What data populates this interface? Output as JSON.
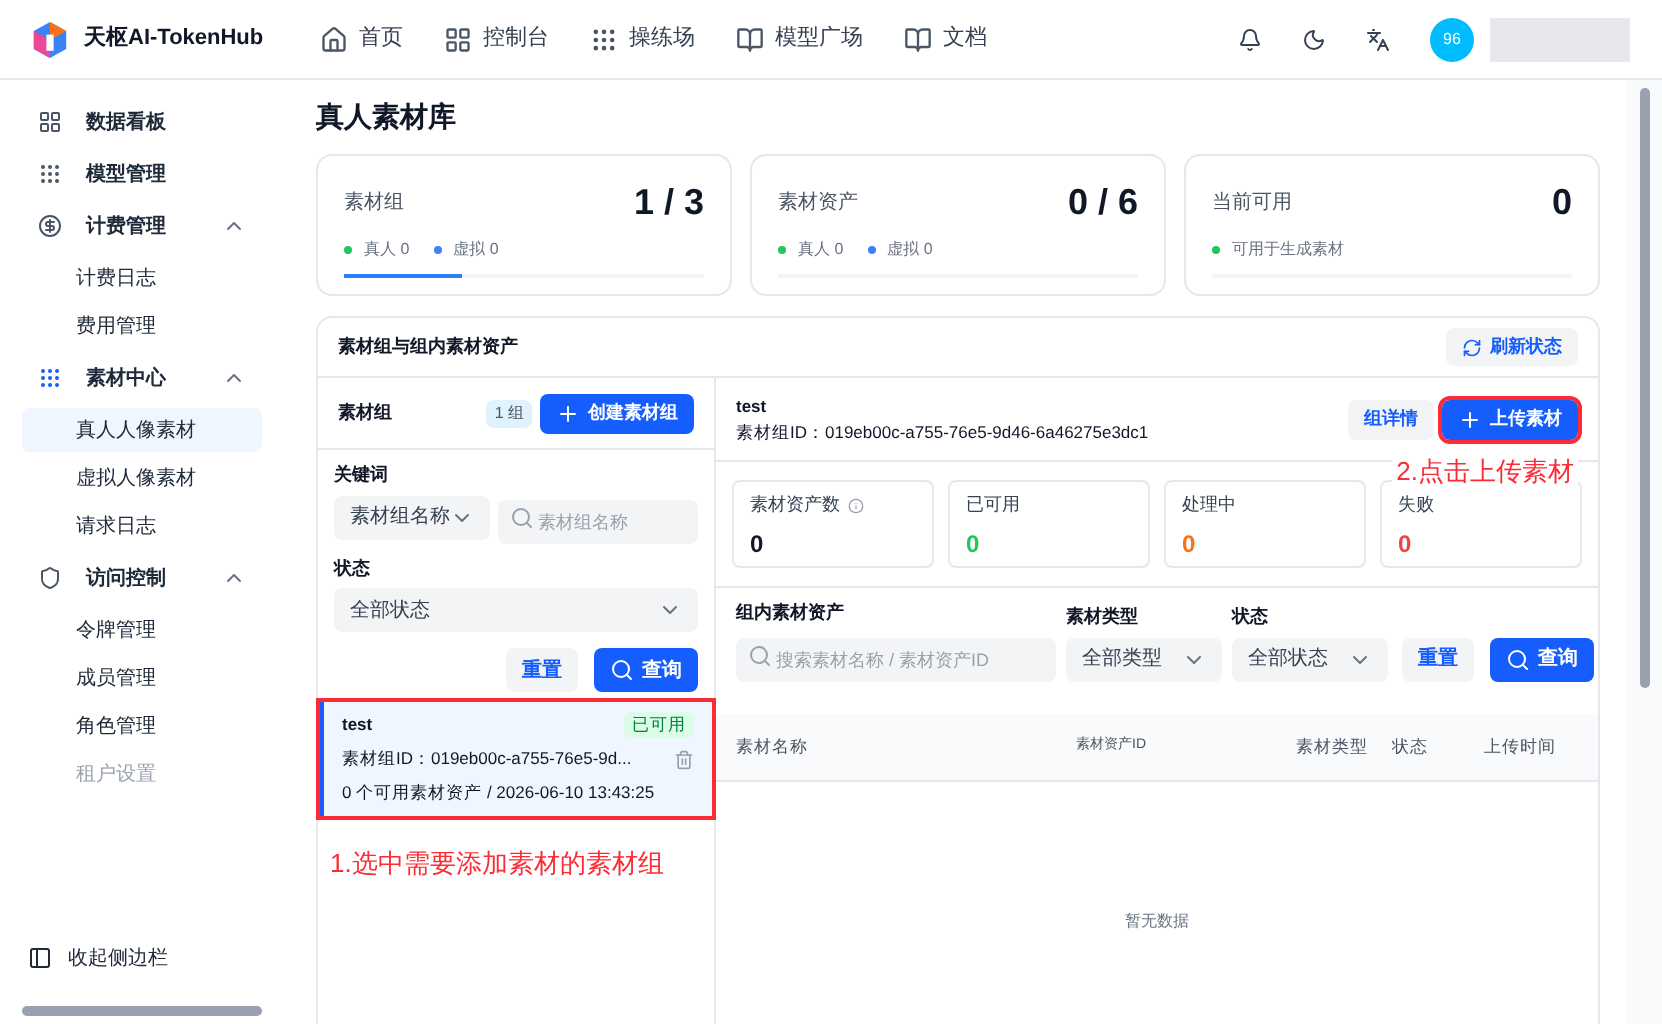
{
  "header": {
    "brand": "天枢AI-TokenHub",
    "nav": [
      {
        "label": "首页",
        "kind": "home"
      },
      {
        "label": "控制台",
        "kind": "grid"
      },
      {
        "label": "操练场",
        "kind": "dots"
      },
      {
        "label": "模型广场",
        "kind": "book"
      },
      {
        "label": "文档",
        "kind": "book"
      }
    ],
    "avatar": "96"
  },
  "sidebar": {
    "items": [
      {
        "label": "数据看板",
        "kind": "grid",
        "active": false
      },
      {
        "label": "模型管理",
        "kind": "dots",
        "active": false
      },
      {
        "label": "计费管理",
        "kind": "billing",
        "active": false,
        "expanded": true,
        "children": [
          {
            "label": "计费日志",
            "selected": false,
            "disabled": false
          },
          {
            "label": "费用管理",
            "selected": false,
            "disabled": false
          }
        ]
      },
      {
        "label": "素材中心",
        "kind": "dots",
        "active": true,
        "expanded": true,
        "children": [
          {
            "label": "真人人像素材",
            "selected": true,
            "disabled": false
          },
          {
            "label": "虚拟人像素材",
            "selected": false,
            "disabled": false
          },
          {
            "label": "请求日志",
            "selected": false,
            "disabled": false
          }
        ]
      },
      {
        "label": "访问控制",
        "kind": "shield",
        "active": false,
        "expanded": true,
        "children": [
          {
            "label": "令牌管理",
            "selected": false,
            "disabled": false
          },
          {
            "label": "成员管理",
            "selected": false,
            "disabled": false
          },
          {
            "label": "角色管理",
            "selected": false,
            "disabled": false
          },
          {
            "label": "租户设置",
            "selected": false,
            "disabled": true
          }
        ]
      }
    ],
    "collapse": "收起侧边栏"
  },
  "page": {
    "title": "真人素材库",
    "stats": [
      {
        "label": "素材组",
        "value": "1 / 3",
        "level": 0.33,
        "legend": [
          {
            "label": "真人 0",
            "color": "#22c55e"
          },
          {
            "label": "虚拟 0",
            "color": "#3b82f6"
          }
        ]
      },
      {
        "label": "素材资产",
        "value": "0 / 6",
        "level": 0,
        "legend": [
          {
            "label": "真人 0",
            "color": "#22c55e"
          },
          {
            "label": "虚拟 0",
            "color": "#3b82f6"
          }
        ]
      },
      {
        "label": "当前可用",
        "value": "0",
        "level": 0,
        "legend": [
          {
            "label": "可用于生成素材",
            "color": "#22c55e"
          }
        ]
      }
    ]
  },
  "panel": {
    "title": "素材组与组内素材资产",
    "refresh_button": "刷新状态",
    "groups": {
      "title": "素材组",
      "count": "1 组",
      "create_button": "创建素材组",
      "keyword_label": "关键词",
      "keyword_type": "素材组名称",
      "keyword_placeholder": "素材组名称",
      "status_label": "状态",
      "status_value": "全部状态",
      "reset_button": "重置",
      "query_button": "查询",
      "items": [
        {
          "name": "test",
          "status": "已可用",
          "id": "素材组ID：019eb00c-a755-76e5-9d...",
          "meta": "0 个可用素材资产 / 2026-06-10 13:43:25",
          "selected": true,
          "highlighted": true
        }
      ],
      "annotation": "1.选中需要添加素材的素材组"
    },
    "detail": {
      "name": "test",
      "id": "素材组ID：019eb00c-a755-76e5-9d46-6a46275e3dc1",
      "detail_button": "组详情",
      "upload_button": {
        "label": "上传素材",
        "highlighted": true
      },
      "annotation": "2.点击上传素材",
      "stats": [
        {
          "label": "素材资产数",
          "value": "0",
          "color": "#111827",
          "info": true
        },
        {
          "label": "已可用",
          "value": "0",
          "color": "#22c55e",
          "info": false
        },
        {
          "label": "处理中",
          "value": "0",
          "color": "#f97316",
          "info": false
        },
        {
          "label": "失败",
          "value": "0",
          "color": "#ef4444",
          "info": false
        }
      ],
      "search_label": "组内素材资产",
      "search_placeholder": "搜索素材名称 / 素材资产ID",
      "type_label": "素材类型",
      "type_value": "全部类型",
      "status_label": "状态",
      "status_value": "全部状态",
      "reset_button": "重置",
      "query_button": "查询",
      "columns": [
        "素材名称",
        "素材资产ID",
        "素材类型",
        "状态",
        "上传时间"
      ],
      "empty": "暂无数据"
    }
  }
}
